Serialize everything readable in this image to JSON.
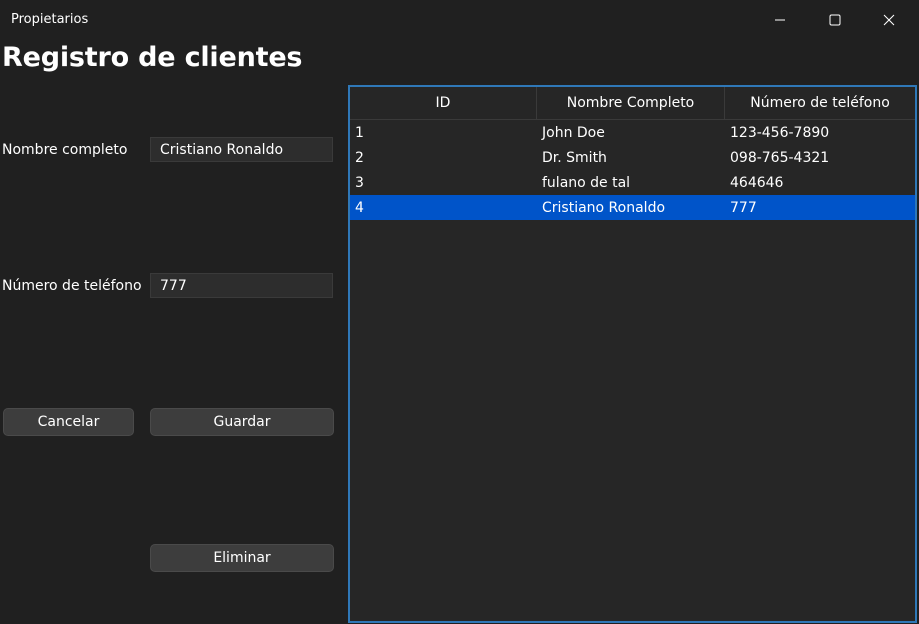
{
  "window": {
    "title": "Propietarios",
    "controls": {
      "minimize_icon": "minimize-icon",
      "maximize_icon": "maximize-icon",
      "close_icon": "close-icon"
    }
  },
  "heading": "Registro de clientes",
  "form": {
    "name_label": "Nombre completo",
    "name_value": "Cristiano Ronaldo",
    "phone_label": "Número de teléfono",
    "phone_value": "777",
    "cancel_label": "Cancelar",
    "save_label": "Guardar",
    "delete_label": "Eliminar"
  },
  "table": {
    "columns": [
      "ID",
      "Nombre Completo",
      "Número de teléfono"
    ],
    "rows": [
      {
        "id": "1",
        "name": "John Doe",
        "phone": "123-456-7890"
      },
      {
        "id": "2",
        "name": "Dr. Smith",
        "phone": "098-765-4321"
      },
      {
        "id": "3",
        "name": "fulano de tal",
        "phone": "464646"
      },
      {
        "id": "4",
        "name": "Cristiano Ronaldo",
        "phone": "777"
      }
    ],
    "selected_row": 3
  },
  "colors": {
    "background": "#202020",
    "selection": "#0054c9",
    "grid_border": "#2f78b8"
  }
}
